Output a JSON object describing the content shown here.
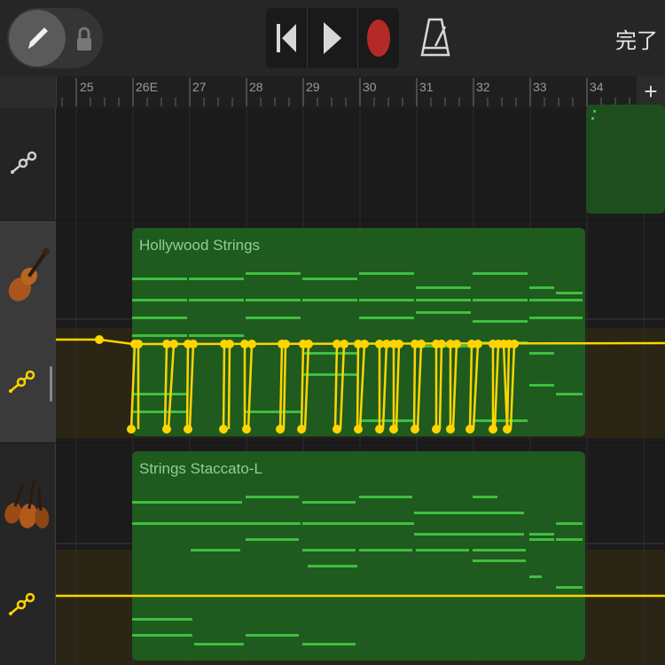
{
  "toolbar": {
    "done_label": "完了",
    "pencil_icon": "pencil-icon",
    "lock_icon": "lock-icon",
    "rewind_icon": "skip-to-start-icon",
    "play_icon": "play-icon",
    "record_icon": "record-icon",
    "metronome_icon": "metronome-icon",
    "record_color": "#b52a26"
  },
  "ruler": {
    "bars": [
      "25",
      "26E",
      "27",
      "28",
      "29",
      "30",
      "31",
      "32",
      "33",
      "34"
    ],
    "add_label": "+"
  },
  "tracks": [
    {
      "icon": "automation-icon",
      "region": null
    },
    {
      "icon": "violin-icon",
      "region": "Hollywood Strings"
    },
    {
      "icon": "violin-section-icon",
      "region": "Strings Staccato-L"
    }
  ],
  "colors": {
    "automation": "#ffd400",
    "region": "#1f5a1f",
    "note": "#3fbf3f"
  }
}
